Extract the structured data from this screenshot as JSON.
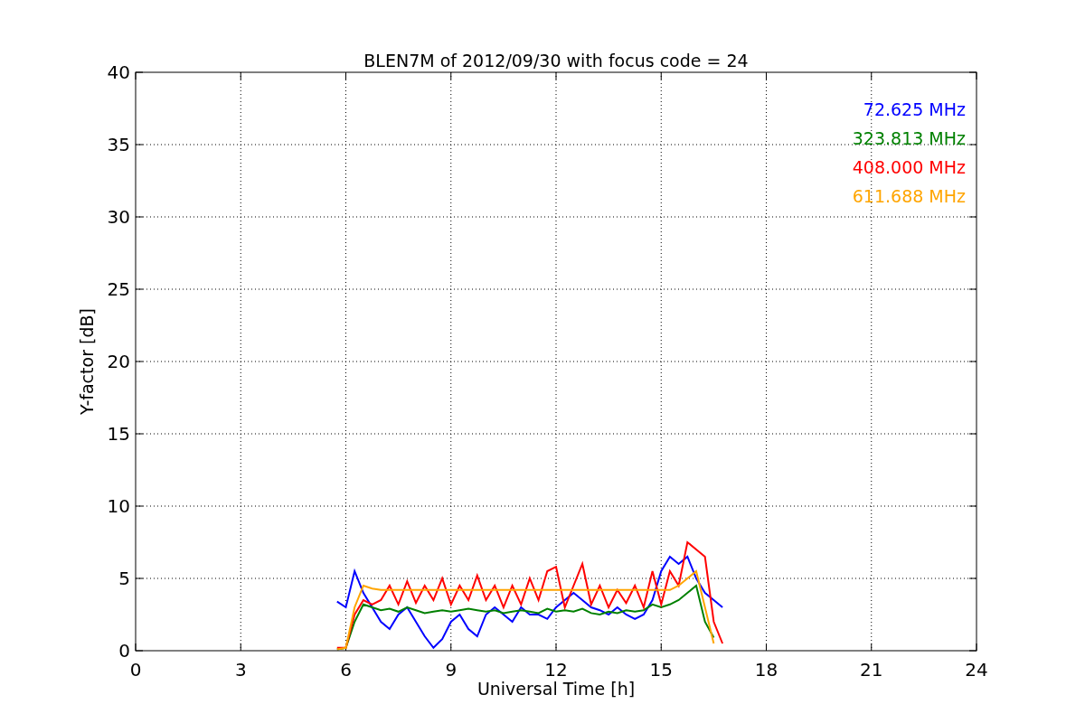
{
  "chart_data": {
    "type": "line",
    "title": "BLEN7M of 2012/09/30 with focus code = 24",
    "xlabel": "Universal Time [h]",
    "ylabel": "Y-factor [dB]",
    "xlim": [
      0,
      24
    ],
    "ylim": [
      0,
      40
    ],
    "xticks": [
      0,
      3,
      6,
      9,
      12,
      15,
      18,
      21,
      24
    ],
    "yticks": [
      0,
      5,
      10,
      15,
      20,
      25,
      30,
      35,
      40
    ],
    "grid": true,
    "x": [
      5.75,
      6,
      6.25,
      6.5,
      6.75,
      7,
      7.25,
      7.5,
      7.75,
      8,
      8.25,
      8.5,
      8.75,
      9,
      9.25,
      9.5,
      9.75,
      10,
      10.25,
      10.5,
      10.75,
      11,
      11.25,
      11.5,
      11.75,
      12,
      12.25,
      12.5,
      12.75,
      13,
      13.25,
      13.5,
      13.75,
      14,
      14.25,
      14.5,
      14.75,
      15,
      15.25,
      15.5,
      15.75,
      16,
      16.25,
      16.5,
      16.75
    ],
    "series": [
      {
        "name": "72.625 MHz",
        "color": "#0000ff",
        "values": [
          3.4,
          3.0,
          5.5,
          4.0,
          3.0,
          2.0,
          1.5,
          2.5,
          3.0,
          2.0,
          1.0,
          0.2,
          0.8,
          2.0,
          2.5,
          1.5,
          1.0,
          2.5,
          3.0,
          2.5,
          2.0,
          3.0,
          2.5,
          2.5,
          2.2,
          3.0,
          3.5,
          4.0,
          3.5,
          3.0,
          2.8,
          2.5,
          3.0,
          2.5,
          2.2,
          2.5,
          3.5,
          5.5,
          6.5,
          6.0,
          6.5,
          5.0,
          4.0,
          3.5,
          3.0
        ]
      },
      {
        "name": "323.813 MHz",
        "color": "#008000",
        "values": [
          0.1,
          0.2,
          2.0,
          3.2,
          3.0,
          2.8,
          2.9,
          2.7,
          3.0,
          2.8,
          2.6,
          2.7,
          2.8,
          2.7,
          2.8,
          2.9,
          2.8,
          2.7,
          2.8,
          2.6,
          2.7,
          2.8,
          2.7,
          2.6,
          2.9,
          2.7,
          2.8,
          2.7,
          2.9,
          2.6,
          2.5,
          2.7,
          2.6,
          2.8,
          2.7,
          2.8,
          3.2,
          3.0,
          3.2,
          3.5,
          4.0,
          4.5,
          2.0,
          0.9,
          null
        ]
      },
      {
        "name": "408.000 MHz",
        "color": "#ff0000",
        "values": [
          0.2,
          0.2,
          2.5,
          3.5,
          3.2,
          3.5,
          4.5,
          3.2,
          4.8,
          3.3,
          4.5,
          3.5,
          5.0,
          3.2,
          4.5,
          3.5,
          5.2,
          3.5,
          4.5,
          3.0,
          4.5,
          3.2,
          5.0,
          3.5,
          5.5,
          5.8,
          3.0,
          4.5,
          6.0,
          3.2,
          4.5,
          3.0,
          4.2,
          3.3,
          4.5,
          3.0,
          5.5,
          3.2,
          5.5,
          4.5,
          7.5,
          7.0,
          6.5,
          2.0,
          0.5
        ]
      },
      {
        "name": "611.688 MHz",
        "color": "#ffa500",
        "values": [
          0.1,
          0.2,
          3.0,
          4.5,
          4.3,
          4.2,
          4.2,
          4.2,
          4.2,
          4.2,
          4.2,
          4.2,
          4.2,
          4.2,
          4.2,
          4.2,
          4.2,
          4.2,
          4.2,
          4.2,
          4.2,
          4.2,
          4.2,
          4.2,
          4.2,
          4.2,
          4.2,
          4.2,
          4.2,
          4.2,
          4.2,
          4.2,
          4.2,
          4.2,
          4.2,
          4.2,
          4.2,
          4.2,
          4.2,
          4.5,
          5.0,
          5.5,
          3.0,
          0.5,
          null
        ]
      }
    ]
  }
}
